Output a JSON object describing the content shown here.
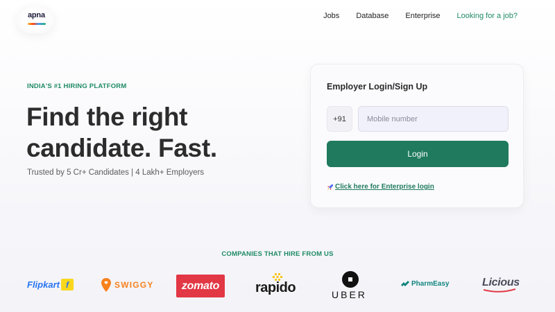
{
  "header": {
    "logo_text": "apna",
    "nav": [
      {
        "label": "Jobs"
      },
      {
        "label": "Database"
      },
      {
        "label": "Enterprise"
      },
      {
        "label": "Looking for a job?"
      }
    ]
  },
  "hero": {
    "tagline": "INDIA'S #1 HIRING PLATFORM",
    "headline": "Find the right candidate. Fast.",
    "trusted": "Trusted by 5 Cr+ Candidates | 4 Lakh+ Employers"
  },
  "login_card": {
    "title": "Employer Login/Sign Up",
    "country_code": "+91",
    "mobile_placeholder": "Mobile number",
    "login_label": "Login",
    "enterprise_link": "Click here for Enterprise login"
  },
  "companies": {
    "title": "COMPANIES THAT HIRE FROM US",
    "brands": [
      {
        "name": "Flipkart"
      },
      {
        "name": "SWIGGY"
      },
      {
        "name": "zomato"
      },
      {
        "name": "rapido"
      },
      {
        "name": "UBER"
      },
      {
        "name": "PharmEasy"
      },
      {
        "name": "Licious"
      }
    ]
  },
  "colors": {
    "accent": "#1f7a5e",
    "accent_text": "#1f8a65",
    "zomato": "#e23744",
    "swiggy": "#f7811d",
    "flipkart": "#2874f0",
    "pharmeasy": "#10847e"
  }
}
